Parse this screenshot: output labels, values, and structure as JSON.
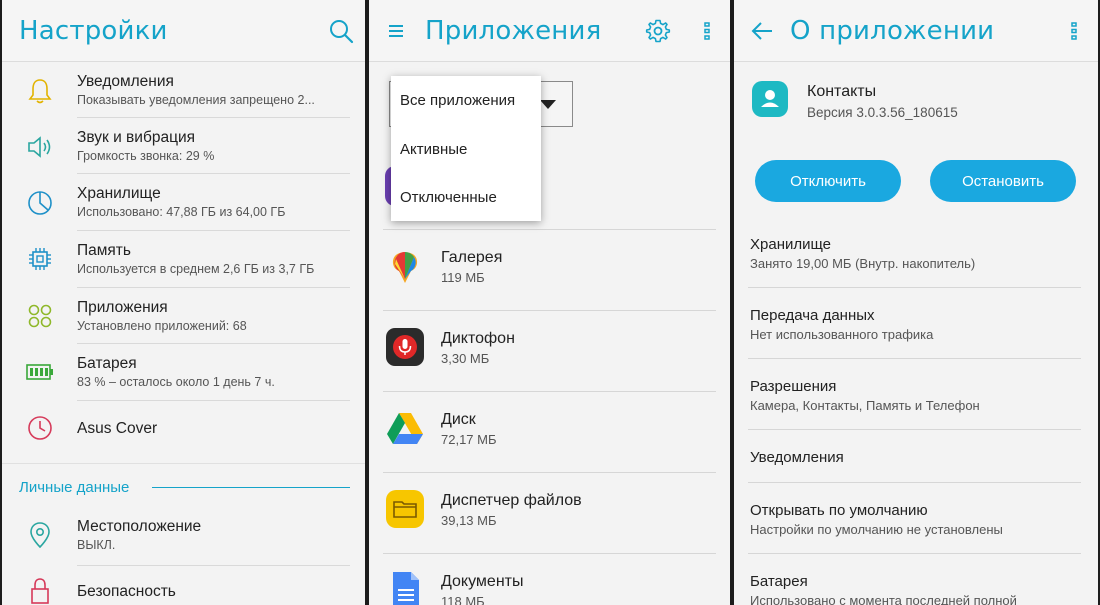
{
  "colors": {
    "accent": "#15a3c9",
    "button": "#1aa8e0"
  },
  "settings": {
    "title": "Настройки",
    "items": [
      {
        "icon": "bell-icon",
        "title": "Уведомления",
        "subtitle": "Показывать уведомления запрещено 2..."
      },
      {
        "icon": "speaker-icon",
        "title": "Звук и вибрация",
        "subtitle": "Громкость звонка: 29 %"
      },
      {
        "icon": "storage-pie-icon",
        "title": "Хранилище",
        "subtitle": "Использовано: 47,88 ГБ из 64,00 ГБ"
      },
      {
        "icon": "memory-chip-icon",
        "title": "Память",
        "subtitle": "Используется в среднем 2,6 ГБ из 3,7 ГБ"
      },
      {
        "icon": "apps-grid-icon",
        "title": "Приложения",
        "subtitle": "Установлено приложений: 68"
      },
      {
        "icon": "battery-icon",
        "title": "Батарея",
        "subtitle": "83 % – осталось около 1 день 7 ч."
      },
      {
        "icon": "clock-cover-icon",
        "title": "Asus Cover",
        "subtitle": ""
      }
    ],
    "section_title": "Личные данные",
    "personal": [
      {
        "icon": "location-pin-icon",
        "title": "Местоположение",
        "subtitle": "ВЫКЛ."
      },
      {
        "icon": "lock-icon",
        "title": "Безопасность",
        "subtitle": ""
      }
    ]
  },
  "apps": {
    "title": "Приложения",
    "filter_options": [
      "Все приложения",
      "Активные",
      "Отключенные"
    ],
    "list": [
      {
        "icon": "gallery-icon",
        "name": "Галерея",
        "size": "119 МБ"
      },
      {
        "icon": "recorder-icon",
        "name": "Диктофон",
        "size": "3,30 МБ"
      },
      {
        "icon": "drive-icon",
        "name": "Диск",
        "size": "72,17 МБ"
      },
      {
        "icon": "file-manager-icon",
        "name": "Диспетчер файлов",
        "size": "39,13 МБ"
      },
      {
        "icon": "docs-icon",
        "name": "Документы",
        "size": "118 МБ"
      }
    ]
  },
  "app_info": {
    "title": "О приложении",
    "app_name": "Контакты",
    "version": "Версия 3.0.3.56_180615",
    "disable_label": "Отключить",
    "stop_label": "Остановить",
    "rows": [
      {
        "title": "Хранилище",
        "subtitle": "Занято 19,00 МБ (Внутр. накопитель)"
      },
      {
        "title": "Передача данных",
        "subtitle": "Нет использованного трафика"
      },
      {
        "title": "Разрешения",
        "subtitle": "Камера, Контакты, Память и Телефон"
      },
      {
        "title": "Уведомления",
        "subtitle": ""
      },
      {
        "title": "Открывать по умолчанию",
        "subtitle": "Настройки по умолчанию не установлены"
      },
      {
        "title": "Батарея",
        "subtitle": "Использовано с момента последней полной"
      }
    ]
  }
}
